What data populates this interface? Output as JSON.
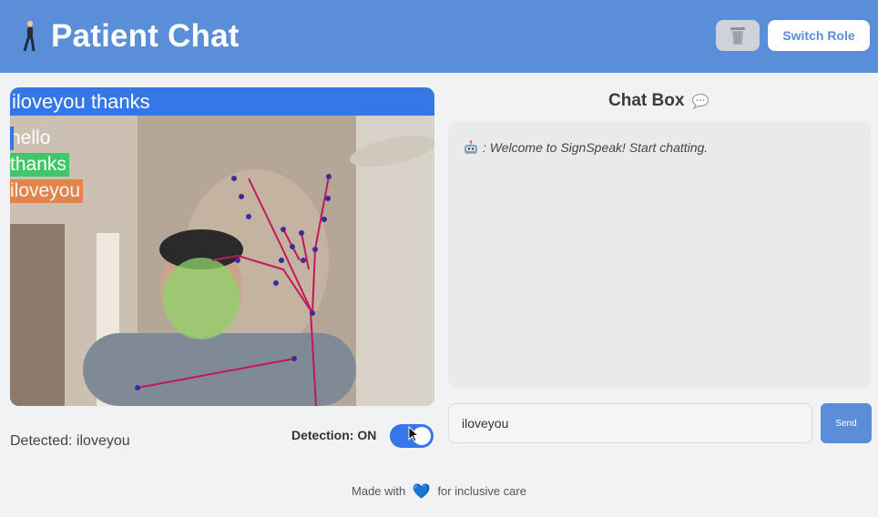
{
  "header": {
    "title": "Patient Chat",
    "switch_role_label": "Switch Role",
    "brand_color": "#5b8ed8",
    "trash_icon": "trash-icon",
    "walker_icon": "person-walking-icon"
  },
  "video": {
    "prediction_text": "iloveyou  thanks",
    "labels": [
      {
        "text": "hello",
        "color": "#ffffff"
      },
      {
        "text": "thanks",
        "color": "#3fc76a"
      },
      {
        "text": "iloveyou",
        "color": "#e77a3a"
      }
    ]
  },
  "detection": {
    "detected_text": "Detected: iloveyou",
    "toggle_label": "Detection: ON",
    "enabled": true
  },
  "chat": {
    "title": "Chat Box",
    "title_icon": "speech-bubble-icon",
    "messages": [
      {
        "sender_icon": "robot-icon",
        "text": ": Welcome to SignSpeak! Start chatting."
      }
    ],
    "input_value": "iloveyou",
    "send_label": "Send"
  },
  "footer": {
    "prefix": "Made with",
    "heart": "💙",
    "suffix": "for inclusive care"
  }
}
